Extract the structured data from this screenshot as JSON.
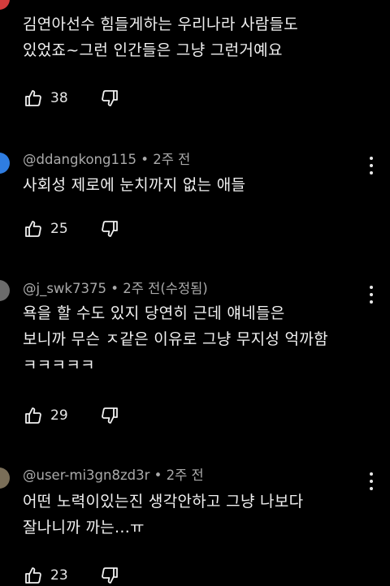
{
  "colors": {
    "background": "#000000",
    "text": "#f1f1f1",
    "meta": "#aaaaaa",
    "avatar_blue": "#2f7de1",
    "avatar_gray": "#6b6b6b",
    "avatar_olive": "#7a6e58",
    "avatar_red": "#d23c3c"
  },
  "comments": [
    {
      "author": "",
      "time": "",
      "lines": [
        "김연아선수 힘들게하는 우리나라 사람들도",
        "있었죠~그런 인간들은 그냥 그런거예요"
      ],
      "likes": "38",
      "icons": [
        "thumb-up-icon",
        "thumb-down-icon"
      ]
    },
    {
      "author": "@ddangkong115",
      "time": "2주 전",
      "lines": [
        "사회성 제로에 눈치까지 없는 애들"
      ],
      "likes": "25",
      "icons": [
        "thumb-up-icon",
        "thumb-down-icon",
        "more-vert-icon"
      ]
    },
    {
      "author": "@j_swk7375",
      "time": "2주 전(수정됨)",
      "lines": [
        "욕을 할 수도 있지 당연히 근데 얘네들은",
        "보니까 무슨 ㅈ같은 이유로 그냥 무지성 억까함",
        "ㅋㅋㅋㅋㅋ"
      ],
      "likes": "29",
      "icons": [
        "thumb-up-icon",
        "thumb-down-icon",
        "more-vert-icon"
      ]
    },
    {
      "author": "@user-mi3gn8zd3r",
      "time": "2주 전",
      "lines": [
        "어떤 노력이있는진 생각안하고 그냥 나보다",
        "잘나니까 까는...ㅠ"
      ],
      "likes": "23",
      "icons": [
        "thumb-up-icon",
        "thumb-down-icon",
        "more-vert-icon"
      ]
    }
  ],
  "separator": "•"
}
